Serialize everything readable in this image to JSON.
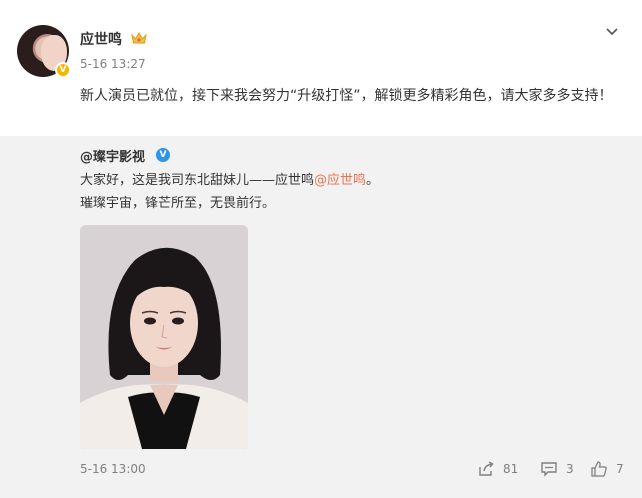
{
  "post": {
    "username": "应世鸣",
    "timestamp": "5-16 13:27",
    "text": "新人演员已就位，接下来我会努力“升级打怪”，解锁更多精彩角色，请大家多多支持！",
    "vip_badge_text": "V"
  },
  "repost": {
    "username": "@璨宇影视",
    "line1_prefix": "大家好，这是我司东北甜妹儿——应世鸣",
    "line1_mention": "@应世鸣",
    "line1_suffix": "。",
    "line2": "璀璨宇宙，锋芒所至，无畏前行。",
    "timestamp": "5-16 13:00",
    "verified_badge_text": "V"
  },
  "actions": {
    "share_count": "81",
    "comment_count": "3",
    "like_count": "7"
  },
  "colors": {
    "mention": "#eb7350",
    "verified_blue": "#2f95e8",
    "vip_gold": "#f7b500",
    "repost_bg": "#f2f2f2"
  },
  "icons": [
    "crown-icon",
    "chevron-down-icon",
    "verified-icon",
    "share-icon",
    "comment-icon",
    "like-icon"
  ]
}
